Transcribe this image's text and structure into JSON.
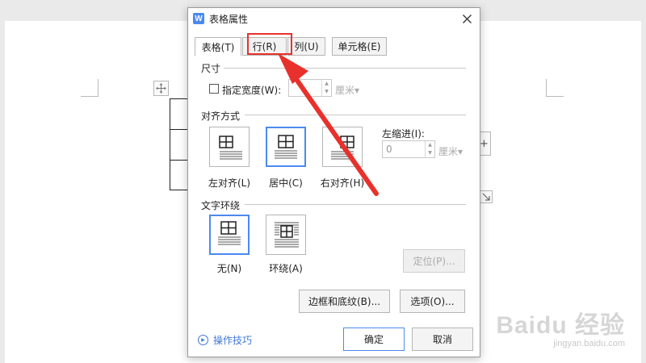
{
  "dialog": {
    "title": "表格属性",
    "app_icon": "W",
    "close_icon": "close-icon",
    "tabs": [
      {
        "label": "表格(T)",
        "active": true
      },
      {
        "label": "行(R)",
        "active": false,
        "highlighted": true
      },
      {
        "label": "列(U)",
        "active": false
      },
      {
        "label": "单元格(E)",
        "active": false
      }
    ],
    "size": {
      "section_label": "尺寸",
      "width_checkbox_label": "指定宽度(W):",
      "width_value": "",
      "width_unit": "厘米▾",
      "checked": false
    },
    "alignment": {
      "section_label": "对齐方式",
      "options": [
        {
          "label": "左对齐(L)",
          "selected": false
        },
        {
          "label": "居中(C)",
          "selected": true
        },
        {
          "label": "右对齐(H)",
          "selected": false
        }
      ],
      "indent_label": "左缩进(I):",
      "indent_value": "0",
      "indent_unit": "厘米▾"
    },
    "wrapping": {
      "section_label": "文字环绕",
      "options": [
        {
          "label": "无(N)",
          "selected": true
        },
        {
          "label": "环绕(A)",
          "selected": false
        }
      ],
      "position_button": "定位(P)..."
    },
    "buttons": {
      "borders": "边框和底纹(B)...",
      "options": "选项(O)...",
      "ok": "确定",
      "cancel": "取消"
    },
    "tips_label": "操作技巧"
  },
  "document": {
    "add_column_symbol": "+"
  },
  "watermark": {
    "logo": "Baidu 经验",
    "url": "jingyan.baidu.com"
  },
  "colors": {
    "accent": "#4a8af0",
    "annotation": "#e8312c"
  }
}
